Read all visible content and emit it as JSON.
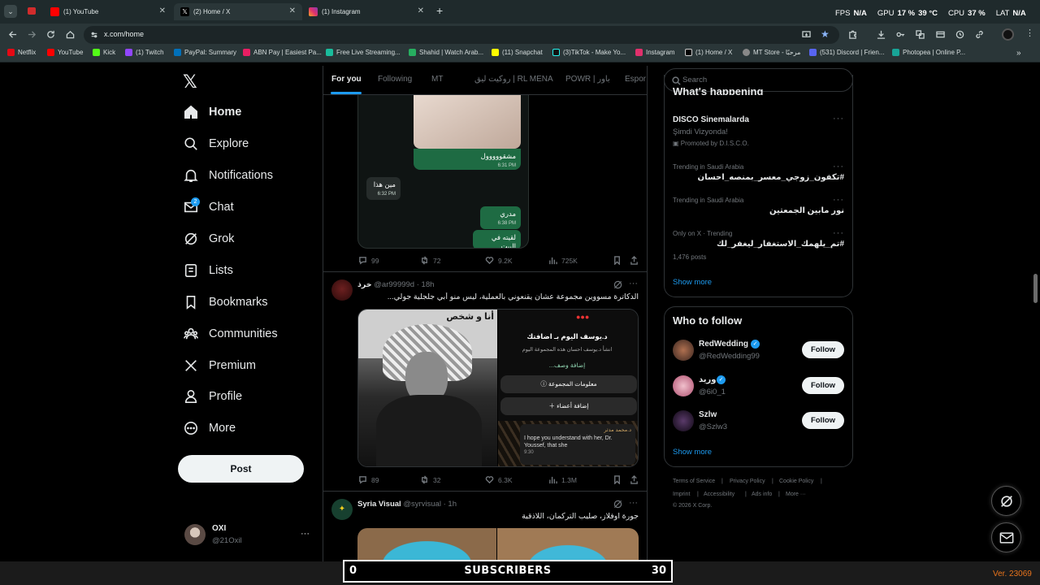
{
  "browser": {
    "tabs": [
      {
        "title": "(1) YouTube",
        "color": "#ff0000"
      },
      {
        "title": "(2) Home / X",
        "color": "#000000"
      },
      {
        "title": "(1) Instagram",
        "color": "#e1306c"
      }
    ],
    "new_tab": "+",
    "url": "x.com/home",
    "bookmarks": [
      {
        "label": "Netflix",
        "color": "#e50914"
      },
      {
        "label": "YouTube",
        "color": "#ff0000"
      },
      {
        "label": "Kick",
        "color": "#53fc18"
      },
      {
        "label": "(1) Twitch",
        "color": "#9146ff"
      },
      {
        "label": "PayPal: Summary",
        "color": "#003087"
      },
      {
        "label": "ABN Pay | Easiest Pa...",
        "color": "#e91e63"
      },
      {
        "label": "Free Live Streaming...",
        "color": "#1abc9c"
      },
      {
        "label": "Shahid | Watch Arab...",
        "color": "#27ae60"
      },
      {
        "label": "(11) Snapchat",
        "color": "#fffc00"
      },
      {
        "label": "(3)TikTok - Make Yo...",
        "color": "#111111"
      },
      {
        "label": "Instagram",
        "color": "#e1306c"
      },
      {
        "label": "(1) Home / X",
        "color": "#000000"
      },
      {
        "label": "MT Store - مرحبًا",
        "color": "#888888"
      },
      {
        "label": "(531) Discord | Frien...",
        "color": "#5865f2"
      },
      {
        "label": "Photopea | Online P...",
        "color": "#18a497"
      }
    ]
  },
  "overlay": {
    "fps_label": "FPS",
    "fps_value": "N/A",
    "gpu_label": "GPU",
    "gpu_value": "17 %",
    "gpu_temp": "39 °C",
    "cpu_label": "CPU",
    "cpu_value": "37 %",
    "lat_label": "LAT",
    "lat_value": "N/A"
  },
  "sidebar": {
    "items": [
      {
        "label": "Home",
        "icon": "home-icon"
      },
      {
        "label": "Explore",
        "icon": "search-icon"
      },
      {
        "label": "Notifications",
        "icon": "bell-icon"
      },
      {
        "label": "Chat",
        "icon": "mail-icon",
        "badge": "2"
      },
      {
        "label": "Grok",
        "icon": "grok-icon"
      },
      {
        "label": "Lists",
        "icon": "list-icon"
      },
      {
        "label": "Bookmarks",
        "icon": "bookmark-icon"
      },
      {
        "label": "Communities",
        "icon": "people-icon"
      },
      {
        "label": "Premium",
        "icon": "x-logo-icon"
      },
      {
        "label": "Profile",
        "icon": "person-icon"
      },
      {
        "label": "More",
        "icon": "more-circle-icon"
      }
    ],
    "post_button": "Post",
    "account": {
      "name": "OXI",
      "handle": "@21Oxil",
      "more": "···"
    }
  },
  "feed": {
    "tabs": [
      "For you",
      "Following",
      "MT",
      "روكيت ليق | RL MENA",
      "POWR | باور",
      "Espor"
    ],
    "post1": {
      "messages": [
        {
          "text": "مشقووووول",
          "time": "6:31 PM"
        },
        {
          "text": "مين هذا",
          "time": "6:32 PM"
        },
        {
          "text": "مدري",
          "time": "6:38 PM"
        },
        {
          "text": "لقيته في البيت",
          "time": "6:38 PM"
        }
      ],
      "actions": {
        "replies": "99",
        "reposts": "72",
        "likes": "9.2K",
        "views": "725K"
      }
    },
    "post2": {
      "name": "خرذ",
      "handle": "@ar99999d",
      "time": "18h",
      "text": "الدكاترة مسووين مجموعة عشان يقنعوني بالعملية، ليس منو أبي جلجلية جولي...",
      "image_caption": "أنا و شخص",
      "phone": {
        "header": "د.يوسف اليوم بـ اضافتك",
        "sub": "انشأ د.يوسف احسان هذه المجموعة اليوم",
        "add_desc": "إضافة وصف...",
        "group_info": "معلومات المجموعة",
        "add_members": "إضافة أعضاء",
        "sender": "د.محمد مدثر",
        "message": "I hope you understand with her, Dr. Youssef, that she",
        "time": "9:30"
      },
      "actions": {
        "replies": "89",
        "reposts": "32",
        "likes": "6.3K",
        "views": "1.3M"
      }
    },
    "post3": {
      "name": "Syria Visual",
      "handle": "@syrvisual",
      "time": "1h",
      "text": "جورة اوفلاز، صليب التركمان، اللاذقية"
    }
  },
  "right": {
    "search_placeholder": "Search",
    "happening_title": "What's happening",
    "trends": [
      {
        "meta": "",
        "title": "DISCO Sinemalarda",
        "sub": "Şimdi Vizyonda!",
        "promo": "Promoted by D.I.S.C.O."
      },
      {
        "meta": "Trending in Saudi Arabia",
        "title": "#تكفون_زوجي_معسر_بمنصه_احسان",
        "sub": "",
        "promo": ""
      },
      {
        "meta": "Trending in Saudi Arabia",
        "title": "نور مابين الجمعتين",
        "sub": "",
        "promo": ""
      },
      {
        "meta": "Only on X · Trending",
        "title": "#تم_يلهمك_الاستغفار_ليغفر_لك",
        "sub": "1,476 posts",
        "promo": ""
      }
    ],
    "show_more": "Show more",
    "who_title": "Who to follow",
    "who": [
      {
        "name": "RedWedding",
        "handle": "@RedWedding99",
        "verified": true,
        "avatar_color": "#6a4b3a"
      },
      {
        "name": "وريد",
        "handle": "@6i0_1",
        "verified": true,
        "avatar_color": "#d88ca0"
      },
      {
        "name": "Szlw",
        "handle": "@Szlw3",
        "verified": false,
        "avatar_color": "#2a1830"
      }
    ],
    "follow_label": "Follow",
    "footer": [
      "Terms of Service",
      "Privacy Policy",
      "Cookie Policy",
      "Imprint",
      "Accessibility",
      "Ads info",
      "More ···",
      "© 2026 X Corp."
    ]
  },
  "stream_overlay": {
    "left_count": "0",
    "title": "SUBSCRIBERS",
    "right_count": "30",
    "version": "Ver. 23069"
  }
}
